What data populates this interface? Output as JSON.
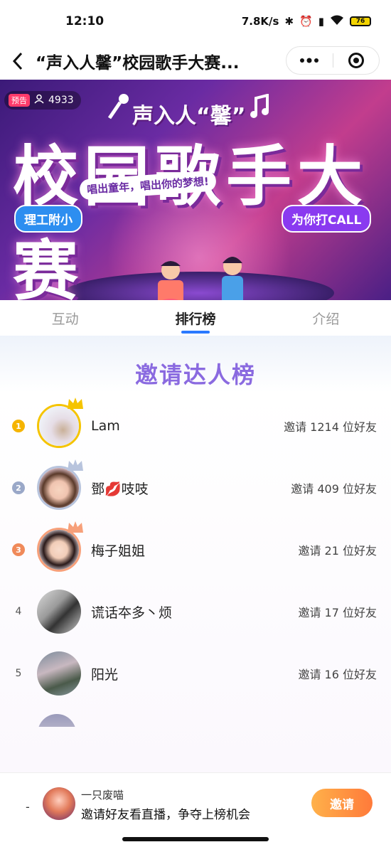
{
  "status_bar": {
    "time": "12:10",
    "net_speed": "7.8K/s",
    "battery": "76"
  },
  "nav": {
    "title": "“声入人馨”校园歌手大赛...",
    "more_icon": "more-dots-icon",
    "close_icon": "target-circle-icon"
  },
  "banner": {
    "viewer_count": "4933",
    "badge_tag": "预告",
    "subtitle": "声入人“馨”",
    "main_title": "校园歌手大赛",
    "slogan": "唱出童年，唱出你的梦想!",
    "left_tag": "理工附小",
    "right_tag": "为你打CALL"
  },
  "tabs": [
    {
      "label": "互动",
      "active": false
    },
    {
      "label": "排行榜",
      "active": true
    },
    {
      "label": "介绍",
      "active": false
    }
  ],
  "board": {
    "title": "邀请达人榜",
    "rows": [
      {
        "rank": "1",
        "name": "Lam",
        "invite": "邀请 1214 位好友",
        "medal_color": "#f5b400"
      },
      {
        "rank": "2",
        "name": "鄧💋吱吱",
        "invite": "邀请 409 位好友",
        "medal_color": "#9aa8c8"
      },
      {
        "rank": "3",
        "name": "梅子姐姐",
        "invite": "邀请 21 位好友",
        "medal_color": "#f08a5a"
      },
      {
        "rank": "4",
        "name": "谎话夲多丶烦",
        "invite": "邀请 17 位好友"
      },
      {
        "rank": "5",
        "name": "阳光",
        "invite": "邀请 16 位好友"
      }
    ]
  },
  "bottom": {
    "dash": "-",
    "name": "一只废喵",
    "desc": "邀请好友看直播，争夺上榜机会",
    "button": "邀请"
  }
}
